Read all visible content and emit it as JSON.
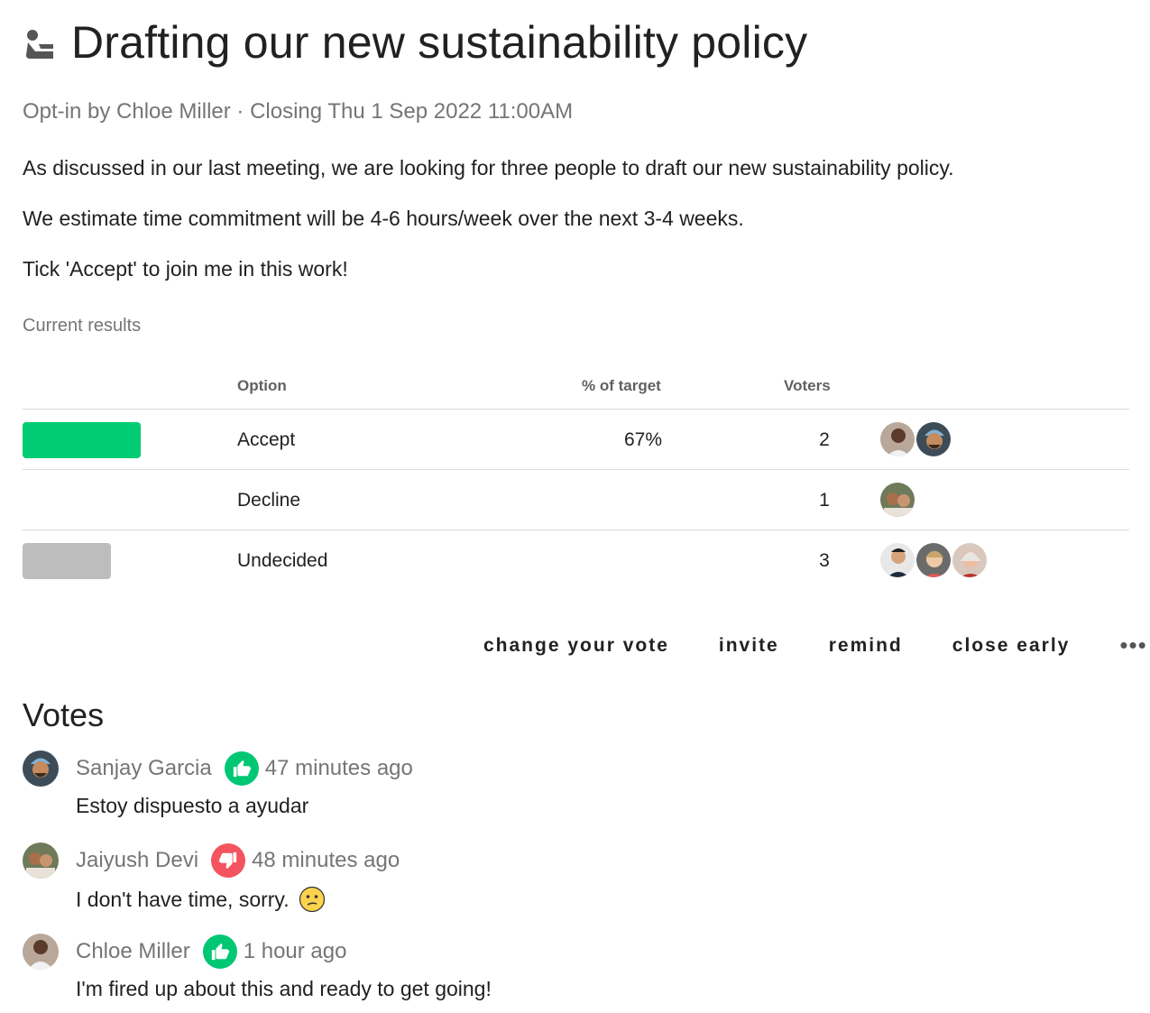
{
  "poll": {
    "title": "Drafting our new sustainability policy",
    "meta": "Opt-in by Chloe Miller · Closing Thu 1 Sep 2022 11:00AM",
    "body": [
      "As discussed in our last meeting, we are looking for three people to draft our new sustainability policy.",
      "We estimate time commitment will be 4-6 hours/week over the next 3-4 weeks.",
      "Tick 'Accept' to join me in this work!"
    ]
  },
  "results": {
    "label": "Current results",
    "headers": {
      "option": "Option",
      "pct": "% of target",
      "voters": "Voters"
    },
    "rows": [
      {
        "option": "Accept",
        "pct": "67%",
        "voters": "2",
        "bar_color": "#00cc73",
        "bar_fraction": 0.67
      },
      {
        "option": "Decline",
        "pct": "",
        "voters": "1",
        "bar_color": "",
        "bar_fraction": 0
      },
      {
        "option": "Undecided",
        "pct": "",
        "voters": "3",
        "bar_color": "#bdbdbd",
        "bar_fraction": 0.5
      }
    ]
  },
  "actions": {
    "change_vote": "change your vote",
    "invite": "invite",
    "remind": "remind",
    "close_early": "close early",
    "more": "•••"
  },
  "votes": {
    "title": "Votes",
    "items": [
      {
        "name": "Sanjay Garcia",
        "stance": "accept",
        "time": "47 minutes ago",
        "text": "Estoy dispuesto a ayudar"
      },
      {
        "name": "Jaiyush Devi",
        "stance": "decline",
        "time": "48 minutes ago",
        "text": "I don't have time, sorry."
      },
      {
        "name": "Chloe Miller",
        "stance": "accept",
        "time": "1 hour ago",
        "text": "I'm fired up about this and ready to get going!"
      }
    ]
  },
  "colors": {
    "accept": "#00c773",
    "decline": "#f4545f",
    "muted": "#757575"
  }
}
